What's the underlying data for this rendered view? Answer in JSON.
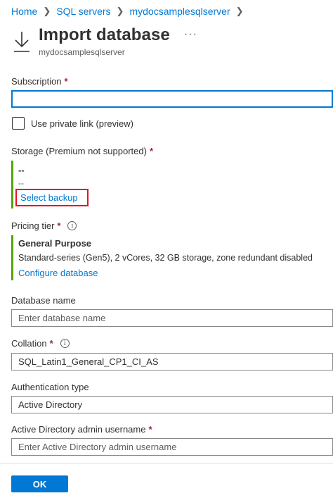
{
  "breadcrumb": {
    "items": [
      "Home",
      "SQL servers",
      "mydocsamplesqlserver"
    ]
  },
  "header": {
    "title": "Import database",
    "subtitle": "mydocsamplesqlserver",
    "more": "···",
    "icon": "download-icon"
  },
  "subscription": {
    "label": "Subscription",
    "required": "*",
    "value": ""
  },
  "private_link": {
    "label": "Use private link (preview)",
    "checked": false
  },
  "storage": {
    "label": "Storage (Premium not supported)",
    "required": "*",
    "value_main": "--",
    "value_sub": "--",
    "select_label": "Select backup",
    "accent": "#57a300"
  },
  "pricing": {
    "label": "Pricing tier",
    "required": "*",
    "tier": "General Purpose",
    "description": "Standard-series (Gen5), 2 vCores, 32 GB storage, zone redundant disabled",
    "configure_label": "Configure database"
  },
  "database_name": {
    "label": "Database name",
    "placeholder": "Enter database name"
  },
  "collation": {
    "label": "Collation",
    "required": "*",
    "value": "SQL_Latin1_General_CP1_CI_AS"
  },
  "auth_type": {
    "label": "Authentication type",
    "value": "Active Directory"
  },
  "admin_username": {
    "label": "Active Directory admin username",
    "required": "*",
    "placeholder": "Enter Active Directory admin username"
  },
  "footer": {
    "ok_label": "OK"
  },
  "colors": {
    "accent": "#0078d4",
    "required": "#a4262c",
    "highlight": "#e81123",
    "success": "#57a300"
  }
}
